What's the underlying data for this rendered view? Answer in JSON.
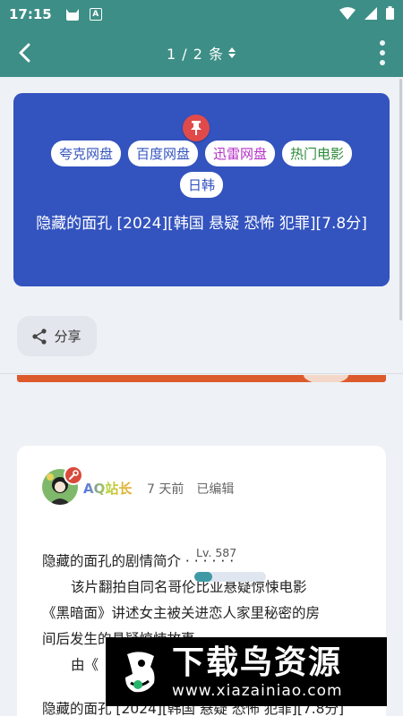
{
  "status_bar": {
    "time": "17:15",
    "notification_icon_letter": "A"
  },
  "app_bar": {
    "title": "1 / 2 条",
    "sort_icon": "unfold-icon",
    "back_icon": "chevron-left-icon",
    "more_icon": "more-vertical-icon"
  },
  "hero": {
    "background_color": "#3353bf",
    "pin_icon": "pin-icon",
    "tags": [
      {
        "label": "夸克网盘",
        "color": "#3353bf"
      },
      {
        "label": "百度网盘",
        "color": "#3353bf"
      },
      {
        "label": "迅雷网盘",
        "color": "#b42fc7"
      },
      {
        "label": "热门电影",
        "color": "#2e8b3a"
      },
      {
        "label": "日韩",
        "color": "#3353bf"
      }
    ],
    "title": "隐藏的面孔 [2024][韩国 悬疑 恐怖 犯罪][7.8分]"
  },
  "share": {
    "label": "分享",
    "icon": "share-icon"
  },
  "post": {
    "author": "AQ站长",
    "time_ago": "7 天前",
    "edited": "已编辑",
    "level": {
      "label": "Lv. 587",
      "progress": 0.25
    },
    "body": [
      "隐藏的面孔的剧情简介 · · · · · ·",
      "该片翻拍自同名哥伦比亚悬疑惊悚电影",
      "《黑暗面》讲述女主被关进恋人家里秘密的房",
      "间后发生的悬疑惊悚故事。",
      "由《"
    ],
    "footer_line": "隐藏的面孔 [2024][韩国 悬疑 恐怖 犯罪][7.8分]"
  },
  "watermark": {
    "title": "下载鸟资源",
    "url": "www.xiazainiao.com"
  }
}
